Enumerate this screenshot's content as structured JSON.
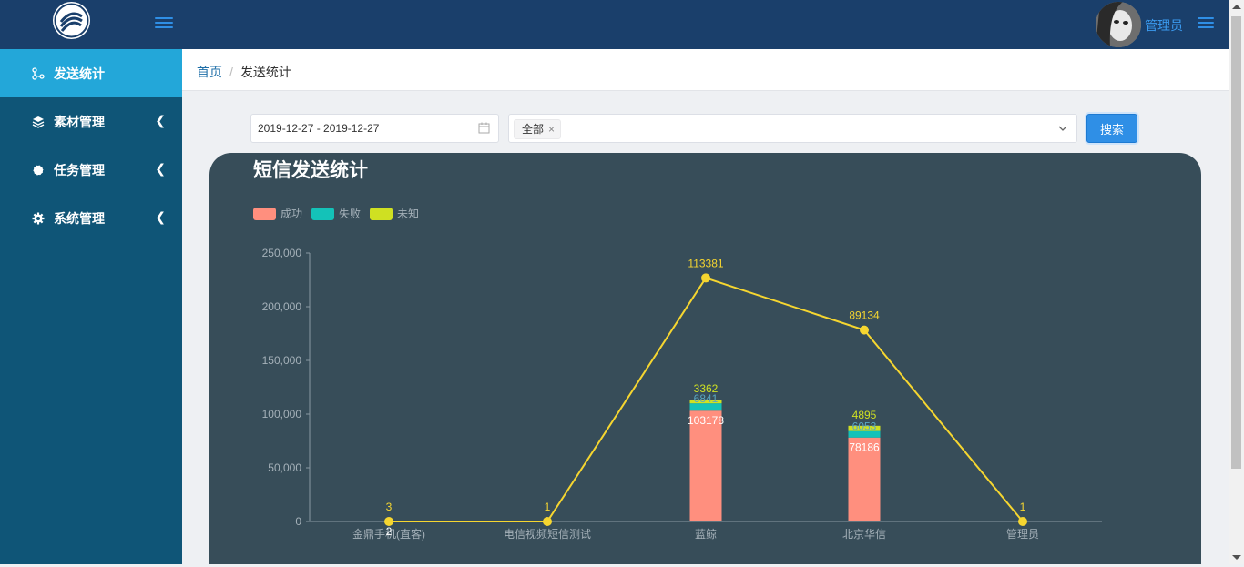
{
  "header": {
    "user_name": "管理员",
    "brand_color": "#1a3f6b",
    "accent_color": "#2f8fe6"
  },
  "sidebar": {
    "items": [
      {
        "label": "发送统计",
        "icon": "branch-icon",
        "active": true
      },
      {
        "label": "素材管理",
        "icon": "layers-icon",
        "arrow": "❮"
      },
      {
        "label": "任务管理",
        "icon": "circle-icon",
        "arrow": "❮"
      },
      {
        "label": "系统管理",
        "icon": "gear-icon",
        "arrow": "❮"
      }
    ]
  },
  "breadcrumb": {
    "home": "首页",
    "separator": "/",
    "current": "发送统计"
  },
  "filters": {
    "date_range": "2019-12-27 - 2019-12-27",
    "selected_tag": "全部",
    "tag_close": "×",
    "search_label": "搜索"
  },
  "chart_data": {
    "type": "bar",
    "title": "短信发送统计",
    "categories": [
      "金鼎手机(直客)",
      "电信视频短信测试",
      "蓝鲸",
      "北京华信",
      "管理员"
    ],
    "stacked": true,
    "series": [
      {
        "name": "成功",
        "type": "bar",
        "color": "#ff8f7e",
        "values": [
          2,
          0,
          103178,
          78186,
          0
        ],
        "labels": [
          "2",
          "",
          "103178",
          "78186",
          ""
        ]
      },
      {
        "name": "失败",
        "type": "bar",
        "color": "#14c2b8",
        "values": [
          0,
          0,
          6841,
          6053,
          0
        ],
        "labels": [
          "",
          "",
          "6841",
          "6053",
          ""
        ]
      },
      {
        "name": "未知",
        "type": "bar",
        "color": "#cfe022",
        "values": [
          1,
          1,
          3362,
          4895,
          1
        ],
        "labels": [
          "",
          "",
          "3362",
          "4895",
          ""
        ]
      }
    ],
    "line": {
      "color": "#f6d630",
      "values": [
        3,
        1,
        113381,
        89134,
        1
      ],
      "labels": [
        "3",
        "1",
        "113381",
        "89134",
        "1"
      ],
      "plot_values": [
        3,
        1,
        226762,
        178268,
        1
      ]
    },
    "ylim": [
      0,
      250000
    ],
    "yticks": [
      "0",
      "50,000",
      "100,000",
      "150,000",
      "200,000",
      "250,000"
    ],
    "ytick_values": [
      0,
      50000,
      100000,
      150000,
      200000,
      250000
    ],
    "legend": "top-left",
    "grid": false
  }
}
